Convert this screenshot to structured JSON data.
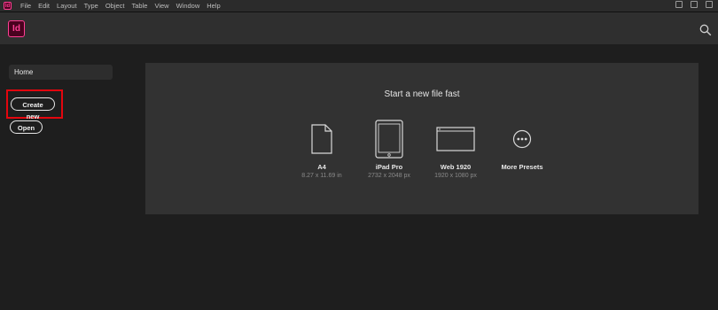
{
  "menubar": {
    "app_letter": "Id",
    "items": [
      "File",
      "Edit",
      "Layout",
      "Type",
      "Object",
      "Table",
      "View",
      "Window",
      "Help"
    ]
  },
  "header": {
    "app_logo": "Id",
    "search_icon": "search-icon"
  },
  "nav": {
    "home_label": "Home",
    "create_new_label": "Create new",
    "open_label": "Open"
  },
  "main": {
    "title": "Start a new file fast",
    "presets": [
      {
        "name": "A4",
        "dims": "8.27 x 11.69 in",
        "icon": "document-icon"
      },
      {
        "name": "iPad Pro",
        "dims": "2732 x 2048 px",
        "icon": "tablet-icon"
      },
      {
        "name": "Web 1920",
        "dims": "1920 x 1080 px",
        "icon": "browser-window-icon"
      },
      {
        "name": "More Presets",
        "dims": "",
        "icon": "more-icon"
      }
    ]
  },
  "colors": {
    "brand": "#ff3f94",
    "brand_bg": "#49021f",
    "highlight": "#e3060e"
  }
}
